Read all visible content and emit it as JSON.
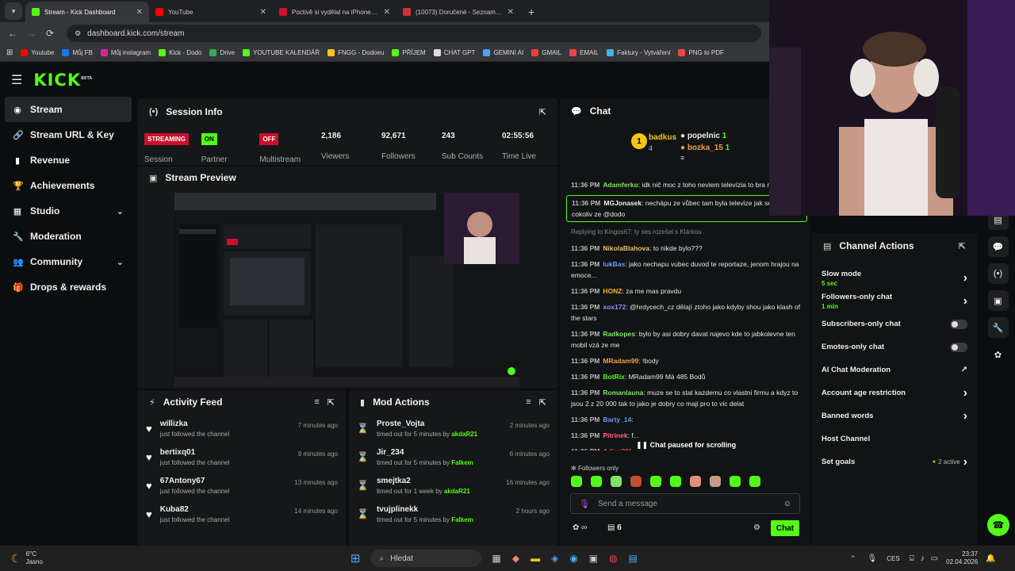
{
  "browser": {
    "tabs": [
      {
        "title": "Stream - Kick Dashboard",
        "color": "#53fc18"
      },
      {
        "title": "YouTube",
        "color": "#ff0000"
      },
      {
        "title": "Poctivě si vydělal na iPhone, po",
        "color": "#d0112b"
      },
      {
        "title": "(10073) Doručené - Seznam Em",
        "color": "#cc3333"
      }
    ],
    "url": "dashboard.kick.com/stream",
    "bookmarks": [
      "Youtube",
      "Můj FB",
      "Můj instagram",
      "Kick - Dodo",
      "Drive",
      "YOUTUBE KALENDÁŘ",
      "FNGG - Dodoeu",
      "PŘÍJEM",
      "CHAT GPT",
      "GEMINI AI",
      "GMAIL",
      "EMAIL",
      "Faktury - Vytváření",
      "PNG to PDF"
    ]
  },
  "sidebar": {
    "items": [
      {
        "label": "Stream",
        "icon": "broadcast-icon",
        "glyph": "((•))"
      },
      {
        "label": "Stream URL & Key",
        "icon": "link-icon",
        "glyph": "🔗"
      },
      {
        "label": "Revenue",
        "icon": "chart-icon",
        "glyph": "▮"
      },
      {
        "label": "Achievements",
        "icon": "trophy-icon",
        "glyph": "🏆"
      },
      {
        "label": "Studio",
        "icon": "studio-icon",
        "glyph": "▦"
      },
      {
        "label": "Moderation",
        "icon": "wrench-icon",
        "glyph": "🔧"
      },
      {
        "label": "Community",
        "icon": "community-icon",
        "glyph": "👥"
      },
      {
        "label": "Drops & rewards",
        "icon": "gift-icon",
        "glyph": "🎁"
      }
    ]
  },
  "session": {
    "title": "Session Info",
    "status_badge": "STREAMING",
    "partner_badge": "ON",
    "multistream_badge": "OFF",
    "labels": {
      "session": "Session",
      "partner": "Partner",
      "multistream": "Multistream"
    },
    "stats": [
      {
        "value": "2,186",
        "label": "Viewers"
      },
      {
        "value": "92,671",
        "label": "Followers"
      },
      {
        "value": "243",
        "label": "Sub Counts"
      },
      {
        "value": "02:55:56",
        "label": "Time Live"
      }
    ]
  },
  "preview": {
    "title": "Stream Preview"
  },
  "activity": {
    "title": "Activity Feed",
    "items": [
      {
        "name": "willizka",
        "text": "just followed the channel",
        "time": "7 minutes ago"
      },
      {
        "name": "bertixq01",
        "text": "just followed the channel",
        "time": "9 minutes ago"
      },
      {
        "name": "67Antony67",
        "text": "just followed the channel",
        "time": "13 minutes ago"
      },
      {
        "name": "Kuba82",
        "text": "just followed the channel",
        "time": "14 minutes ago"
      }
    ]
  },
  "mod": {
    "title": "Mod Actions",
    "items": [
      {
        "name": "Proste_Vojta",
        "pre": "timed out for 5 minutes by ",
        "by": "akdaR21",
        "time": "2 minutes ago"
      },
      {
        "name": "Jir_234",
        "pre": "timed out for 5 minutes by ",
        "by": "Falkem",
        "time": "6 minutes ago"
      },
      {
        "name": "smejtka2",
        "pre": "timed out for 1 week by ",
        "by": "akdaR21",
        "time": "16 minutes ago"
      },
      {
        "name": "tvujplinekk",
        "pre": "timed out for 5 minutes by ",
        "by": "Falkem",
        "time": "2 hours ago"
      }
    ]
  },
  "chat": {
    "title": "Chat",
    "leaders": [
      {
        "rank": "1",
        "name": "badkus",
        "count": "4"
      },
      {
        "name": "popelnic",
        "count": "1"
      },
      {
        "name": "bozka_15",
        "count": "1"
      }
    ],
    "reply_hint": "Replying to Kingos67: ty ses rozešel s Klárkou",
    "messages": [
      {
        "time": "11:36 PM",
        "user": "Adamferko",
        "color": "#7ee36a",
        "text": "idk nič moc z toho neviem televízia to bra nahrotila"
      },
      {
        "time": "11:36 PM",
        "user": "MGJonasek",
        "color": "#f0f0f0",
        "text": "nechápu ze vůbec tam byla televize jak se stát cokoliv ze @dodo",
        "highlight": true
      },
      {
        "time": "11:36 PM",
        "user": "NikolaBlahova",
        "color": "#e9c46a",
        "text": "to nikde bylo???"
      },
      {
        "time": "11:36 PM",
        "user": "lukBas",
        "color": "#6c9bff",
        "text": "jako nechapu vubec duvod te reportaze, jenom hrajou na emoce..."
      },
      {
        "time": "11:36 PM",
        "user": "HONZ",
        "color": "#f7b731",
        "text": "za me mas pravdu"
      },
      {
        "time": "11:36 PM",
        "user": "xox172",
        "color": "#9b8cff",
        "text": "@hrdycech_cz dělají ztoho jako kdyby shou jako klash of the stars"
      },
      {
        "time": "11:36 PM",
        "user": "Radkopes",
        "color": "#7ee36a",
        "text": "bylo by asi dobry davat najevo kde to jabkolevne ten mobil vzá ze me"
      },
      {
        "time": "11:36 PM",
        "user": "MRadam99",
        "color": "#f0a04b",
        "text": "!body"
      },
      {
        "time": "11:36 PM",
        "user": "BotRix",
        "color": "#53fc18",
        "text": "MRadam99 Má 485 Bodů"
      },
      {
        "time": "11:36 PM",
        "user": "Romanlauna",
        "color": "#7ee36a",
        "text": "muze se to stat kazdemu co vlastni firmu a kdyz to jsou 2 z 20 000 tak to jako je dobry co maji pro to vic delat"
      },
      {
        "time": "11:36 PM",
        "user": "Barty_14",
        "color": "#6c9bff",
        "text": ""
      },
      {
        "time": "11:36 PM",
        "user": "Pitrinek",
        "color": "#ff6b81",
        "text": "f..."
      },
      {
        "time": "11:36 PM",
        "user": "Adiex386...",
        "color": "#ff4d4d",
        "text": ""
      }
    ],
    "paused_text": "Chat paused for scrolling",
    "followers_only": "Followers only",
    "placeholder": "Send a message",
    "send_label": "Chat",
    "viewer_count": "6"
  },
  "actions": {
    "title": "Channel Actions",
    "rows": [
      {
        "label": "Slow mode",
        "sub": "5 sec",
        "kind": "arrow"
      },
      {
        "label": "Followers-only chat",
        "sub": "1 min",
        "kind": "arrow"
      },
      {
        "label": "Subscribers-only chat",
        "sub": "",
        "kind": "toggle"
      },
      {
        "label": "Emotes-only chat",
        "sub": "",
        "kind": "toggle"
      },
      {
        "label": "AI Chat Moderation",
        "sub": "",
        "kind": "ext"
      },
      {
        "label": "Account age restriction",
        "sub": "",
        "kind": "arrow"
      },
      {
        "label": "Banned words",
        "sub": "",
        "kind": "arrow"
      },
      {
        "label": "Host Channel",
        "sub": "",
        "kind": "none"
      },
      {
        "label": "Set goals",
        "sub": "",
        "kind": "goal",
        "extra": "2 active"
      }
    ]
  },
  "taskbar": {
    "temp": "6°C",
    "weather": "Jasno",
    "search": "Hledat",
    "lang": "CES",
    "time": "23:37",
    "date": "02.04.2026"
  }
}
